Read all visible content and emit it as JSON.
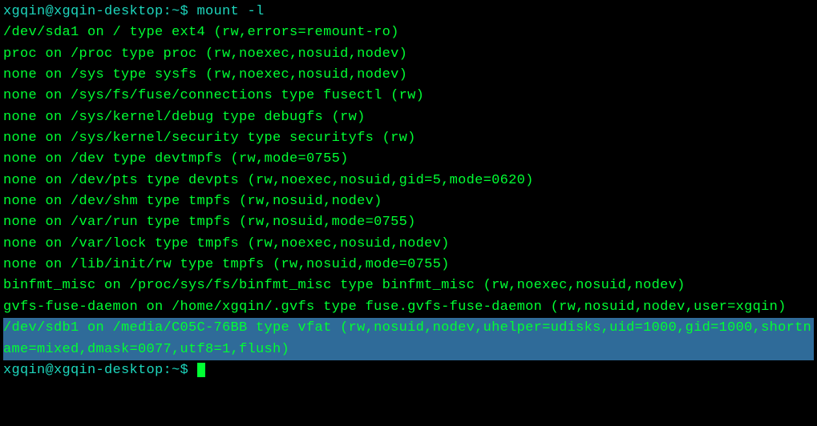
{
  "prompt1": "xgqin@xgqin-desktop:~$ ",
  "command": "mount -l",
  "output_lines": [
    "/dev/sda1 on / type ext4 (rw,errors=remount-ro)",
    "proc on /proc type proc (rw,noexec,nosuid,nodev)",
    "none on /sys type sysfs (rw,noexec,nosuid,nodev)",
    "none on /sys/fs/fuse/connections type fusectl (rw)",
    "none on /sys/kernel/debug type debugfs (rw)",
    "none on /sys/kernel/security type securityfs (rw)",
    "none on /dev type devtmpfs (rw,mode=0755)",
    "none on /dev/pts type devpts (rw,noexec,nosuid,gid=5,mode=0620)",
    "none on /dev/shm type tmpfs (rw,nosuid,nodev)",
    "none on /var/run type tmpfs (rw,nosuid,mode=0755)",
    "none on /var/lock type tmpfs (rw,noexec,nosuid,nodev)",
    "none on /lib/init/rw type tmpfs (rw,nosuid,mode=0755)",
    "binfmt_misc on /proc/sys/fs/binfmt_misc type binfmt_misc (rw,noexec,nosuid,nodev)",
    "gvfs-fuse-daemon on /home/xgqin/.gvfs type fuse.gvfs-fuse-daemon (rw,nosuid,nodev,user=xgqin)"
  ],
  "highlighted_line": "/dev/sdb1 on /media/C05C-76BB type vfat (rw,nosuid,nodev,uhelper=udisks,uid=1000,gid=1000,shortname=mixed,dmask=0077,utf8=1,flush)",
  "prompt2": "xgqin@xgqin-desktop:~$ "
}
